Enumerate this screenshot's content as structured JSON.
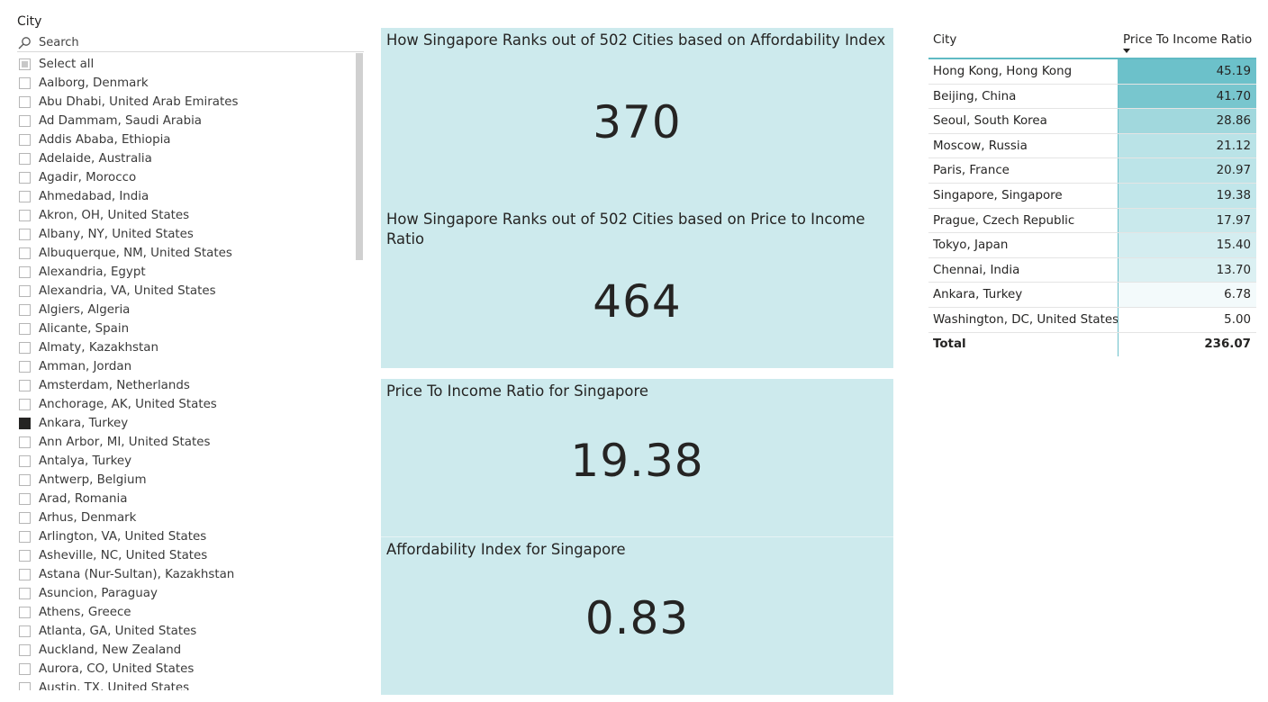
{
  "slicer": {
    "title": "City",
    "search_placeholder": "Search",
    "select_all_label": "Select all",
    "items": [
      {
        "label": "Aalborg, Denmark",
        "checked": false
      },
      {
        "label": "Abu Dhabi, United Arab Emirates",
        "checked": false
      },
      {
        "label": "Ad Dammam, Saudi Arabia",
        "checked": false
      },
      {
        "label": "Addis Ababa, Ethiopia",
        "checked": false
      },
      {
        "label": "Adelaide, Australia",
        "checked": false
      },
      {
        "label": "Agadir, Morocco",
        "checked": false
      },
      {
        "label": "Ahmedabad, India",
        "checked": false
      },
      {
        "label": "Akron, OH, United States",
        "checked": false
      },
      {
        "label": "Albany, NY, United States",
        "checked": false
      },
      {
        "label": "Albuquerque, NM, United States",
        "checked": false
      },
      {
        "label": "Alexandria, Egypt",
        "checked": false
      },
      {
        "label": "Alexandria, VA, United States",
        "checked": false
      },
      {
        "label": "Algiers, Algeria",
        "checked": false
      },
      {
        "label": "Alicante, Spain",
        "checked": false
      },
      {
        "label": "Almaty, Kazakhstan",
        "checked": false
      },
      {
        "label": "Amman, Jordan",
        "checked": false
      },
      {
        "label": "Amsterdam, Netherlands",
        "checked": false
      },
      {
        "label": "Anchorage, AK, United States",
        "checked": false
      },
      {
        "label": "Ankara, Turkey",
        "checked": true
      },
      {
        "label": "Ann Arbor, MI, United States",
        "checked": false
      },
      {
        "label": "Antalya, Turkey",
        "checked": false
      },
      {
        "label": "Antwerp, Belgium",
        "checked": false
      },
      {
        "label": "Arad, Romania",
        "checked": false
      },
      {
        "label": "Arhus, Denmark",
        "checked": false
      },
      {
        "label": "Arlington, VA, United States",
        "checked": false
      },
      {
        "label": "Asheville, NC, United States",
        "checked": false
      },
      {
        "label": "Astana (Nur-Sultan), Kazakhstan",
        "checked": false
      },
      {
        "label": "Asuncion, Paraguay",
        "checked": false
      },
      {
        "label": "Athens, Greece",
        "checked": false
      },
      {
        "label": "Atlanta, GA, United States",
        "checked": false
      },
      {
        "label": "Auckland, New Zealand",
        "checked": false
      },
      {
        "label": "Aurora, CO, United States",
        "checked": false
      },
      {
        "label": "Austin, TX, United States",
        "checked": false
      }
    ]
  },
  "cards": {
    "affordability_rank": {
      "title": "How Singapore Ranks out of 502 Cities based on Affordability Index",
      "value": "370"
    },
    "ratio_rank": {
      "title": "How Singapore Ranks out of 502 Cities based on Price to Income Ratio",
      "value": "464"
    },
    "ratio_value": {
      "title": "Price To Income Ratio for Singapore",
      "value": "19.38"
    },
    "affordability_value": {
      "title": "Affordability Index for Singapore",
      "value": "0.83"
    }
  },
  "table": {
    "columns": [
      "City",
      "Price To Income Ratio"
    ],
    "rows": [
      {
        "city": "Hong Kong, Hong Kong",
        "value": "45.19",
        "color": "#6cc1ca"
      },
      {
        "city": "Beijing, China",
        "value": "41.70",
        "color": "#78c6ce"
      },
      {
        "city": "Seoul, South Korea",
        "value": "28.86",
        "color": "#a1d8dd"
      },
      {
        "city": "Moscow, Russia",
        "value": "21.12",
        "color": "#bae3e7"
      },
      {
        "city": "Paris, France",
        "value": "20.97",
        "color": "#bce4e8"
      },
      {
        "city": "Singapore, Singapore",
        "value": "19.38",
        "color": "#c1e6ea"
      },
      {
        "city": "Prague, Czech Republic",
        "value": "17.97",
        "color": "#c9e9ec"
      },
      {
        "city": "Tokyo, Japan",
        "value": "15.40",
        "color": "#d4edf0"
      },
      {
        "city": "Chennai, India",
        "value": "13.70",
        "color": "#dbf0f2"
      },
      {
        "city": "Ankara, Turkey",
        "value": "6.78",
        "color": "#f3fafb"
      },
      {
        "city": "Washington, DC, United States",
        "value": "5.00",
        "color": "#ffffff"
      }
    ],
    "total_label": "Total",
    "total_value": "236.07"
  },
  "colors": {
    "card_background": "#cdeaed",
    "table_accent": "#5fbac4"
  }
}
